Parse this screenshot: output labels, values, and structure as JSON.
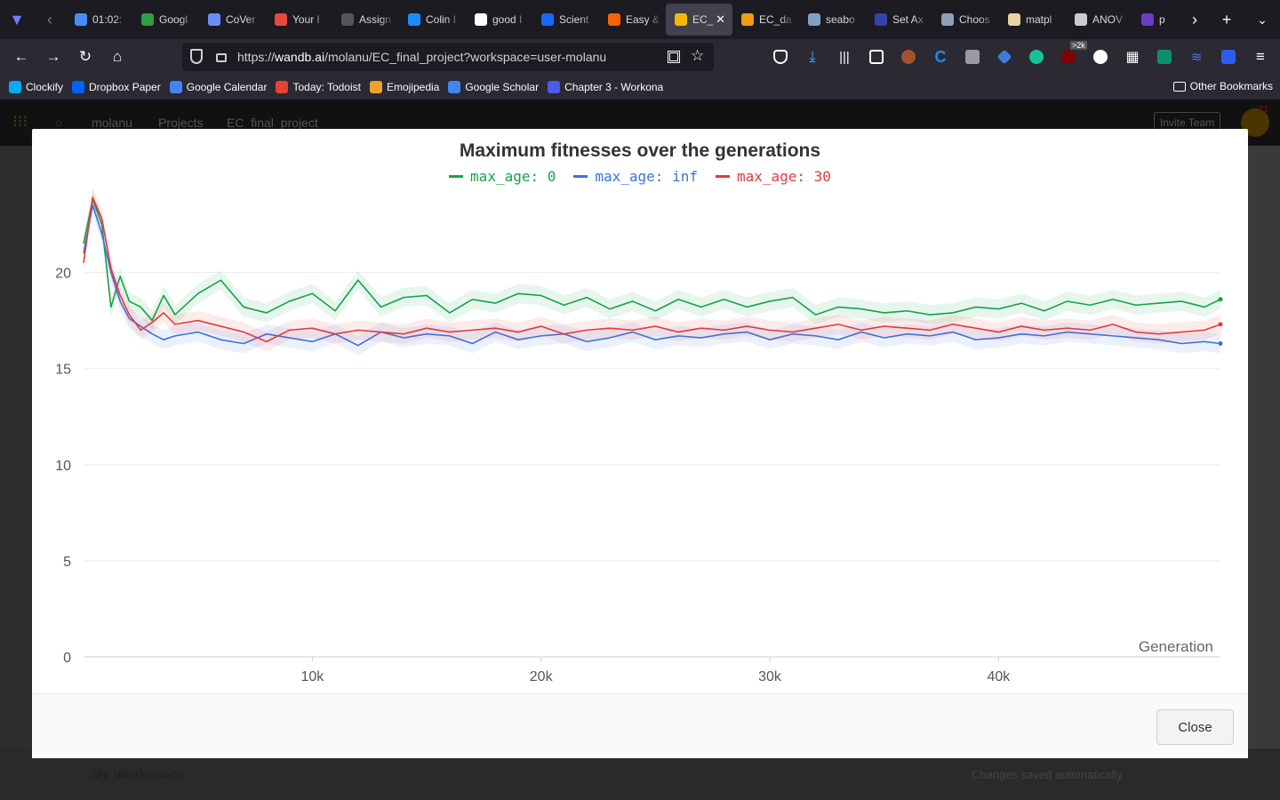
{
  "browser": {
    "tabs": [
      {
        "title": "01:02:",
        "color": "#4a8cf7"
      },
      {
        "title": "Googl",
        "color": "#2f9e44"
      },
      {
        "title": "CoVer",
        "color": "#6c8cf5"
      },
      {
        "title": "Your l",
        "color": "#e8483b"
      },
      {
        "title": "Assign",
        "color": "#555555"
      },
      {
        "title": "Colin I",
        "color": "#1a8cff"
      },
      {
        "title": "good I",
        "color": "#ffffff"
      },
      {
        "title": "Scient",
        "color": "#1769ff"
      },
      {
        "title": "Easy &",
        "color": "#f56400"
      },
      {
        "title": "EC_",
        "color": "#f5b800",
        "active": true
      },
      {
        "title": "EC_da",
        "color": "#f29a13"
      },
      {
        "title": "seabo",
        "color": "#7ea2c4"
      },
      {
        "title": "Set Ax",
        "color": "#3344aa"
      },
      {
        "title": "Choos",
        "color": "#8aa0b8"
      },
      {
        "title": "matpl",
        "color": "#e6d3a0"
      },
      {
        "title": "ANOV",
        "color": "#cccccc"
      },
      {
        "title": "p",
        "color": "#6a3cc8"
      }
    ],
    "url_prefix": "https://",
    "url_host": "wandb.ai",
    "url_path": "/molanu/EC_final_project?workspace=user-molanu",
    "badge": ">2k",
    "bookmarks": [
      {
        "label": "Clockify",
        "color": "#03a9f4"
      },
      {
        "label": "Dropbox Paper",
        "color": "#0061fe"
      },
      {
        "label": "Google Calendar",
        "color": "#4285f4"
      },
      {
        "label": "Today: Todoist",
        "color": "#e44332"
      },
      {
        "label": "Emojipedia",
        "color": "#f0a030"
      },
      {
        "label": "Google Scholar",
        "color": "#4285f4"
      },
      {
        "label": "Chapter 3 - Workona",
        "color": "#4a5cf0"
      }
    ],
    "other_bookmarks": "Other Bookmarks"
  },
  "page": {
    "breadcrumb": [
      "molanu",
      "Projects",
      "EC_final_project"
    ],
    "invite": "Invite Team",
    "workspace": "My Workspace",
    "saved": "Changes saved automatically",
    "notif_count": "21"
  },
  "modal": {
    "close_label": "Close"
  },
  "chart_data": {
    "type": "line",
    "title": "Maximum fitnesses over the generations",
    "xlabel": "Generation",
    "ylabel": "",
    "xlim": [
      0,
      49700
    ],
    "ylim": [
      0,
      24
    ],
    "x_ticks": [
      10000,
      20000,
      30000,
      40000
    ],
    "x_tick_labels": [
      "10k",
      "20k",
      "30k",
      "40k"
    ],
    "y_ticks": [
      0,
      5,
      10,
      15,
      20
    ],
    "legend_position": "top-center",
    "grid": true,
    "series": [
      {
        "name": "max_age: 0",
        "color": "#16a34a",
        "x": [
          0,
          400,
          800,
          1200,
          1600,
          2000,
          2500,
          3000,
          3500,
          4000,
          5000,
          6000,
          7000,
          8000,
          9000,
          10000,
          11000,
          12000,
          13000,
          14000,
          15000,
          16000,
          17000,
          18000,
          19000,
          20000,
          21000,
          22000,
          23000,
          24000,
          25000,
          26000,
          27000,
          28000,
          29000,
          30000,
          31000,
          32000,
          33000,
          34000,
          35000,
          36000,
          37000,
          38000,
          39000,
          40000,
          41000,
          42000,
          43000,
          44000,
          45000,
          46000,
          47000,
          48000,
          49000,
          49700
        ],
        "y": [
          21.5,
          23.8,
          22.5,
          18.2,
          19.8,
          18.5,
          18.2,
          17.5,
          18.8,
          17.8,
          18.9,
          19.6,
          18.2,
          17.9,
          18.5,
          18.9,
          18.0,
          19.6,
          18.2,
          18.7,
          18.8,
          17.9,
          18.6,
          18.4,
          18.9,
          18.8,
          18.3,
          18.7,
          18.1,
          18.5,
          18.0,
          18.6,
          18.2,
          18.6,
          18.2,
          18.5,
          18.7,
          17.8,
          18.2,
          18.1,
          17.9,
          18.0,
          17.8,
          17.9,
          18.2,
          18.1,
          18.4,
          18.0,
          18.5,
          18.3,
          18.6,
          18.3,
          18.4,
          18.5,
          18.2,
          18.6
        ]
      },
      {
        "name": "max_age: inf",
        "color": "#3b72e0",
        "x": [
          0,
          400,
          800,
          1200,
          1600,
          2000,
          2500,
          3000,
          3500,
          4000,
          5000,
          6000,
          7000,
          8000,
          9000,
          10000,
          11000,
          12000,
          13000,
          14000,
          15000,
          16000,
          17000,
          18000,
          19000,
          20000,
          21000,
          22000,
          23000,
          24000,
          25000,
          26000,
          27000,
          28000,
          29000,
          30000,
          31000,
          32000,
          33000,
          34000,
          35000,
          36000,
          37000,
          38000,
          39000,
          40000,
          41000,
          42000,
          43000,
          44000,
          45000,
          46000,
          47000,
          48000,
          49000,
          49700
        ],
        "y": [
          21.0,
          23.5,
          22.0,
          20.0,
          18.5,
          17.6,
          17.2,
          16.8,
          16.5,
          16.7,
          16.9,
          16.5,
          16.3,
          16.8,
          16.6,
          16.4,
          16.8,
          16.2,
          16.9,
          16.6,
          16.8,
          16.7,
          16.3,
          16.9,
          16.5,
          16.7,
          16.8,
          16.4,
          16.6,
          16.9,
          16.5,
          16.7,
          16.6,
          16.8,
          16.9,
          16.5,
          16.8,
          16.7,
          16.5,
          16.9,
          16.6,
          16.8,
          16.7,
          16.9,
          16.5,
          16.6,
          16.8,
          16.7,
          16.9,
          16.8,
          16.7,
          16.6,
          16.5,
          16.3,
          16.4,
          16.3
        ]
      },
      {
        "name": "max_age: 30",
        "color": "#e33a3a",
        "x": [
          0,
          400,
          800,
          1200,
          1600,
          2000,
          2500,
          3000,
          3500,
          4000,
          5000,
          6000,
          7000,
          8000,
          9000,
          10000,
          11000,
          12000,
          13000,
          14000,
          15000,
          16000,
          17000,
          18000,
          19000,
          20000,
          21000,
          22000,
          23000,
          24000,
          25000,
          26000,
          27000,
          28000,
          29000,
          30000,
          31000,
          32000,
          33000,
          34000,
          35000,
          36000,
          37000,
          38000,
          39000,
          40000,
          41000,
          42000,
          43000,
          44000,
          45000,
          46000,
          47000,
          48000,
          49000,
          49700
        ],
        "y": [
          20.5,
          23.9,
          22.8,
          20.2,
          18.8,
          17.8,
          17.0,
          17.4,
          17.9,
          17.3,
          17.5,
          17.2,
          16.9,
          16.4,
          17.0,
          17.1,
          16.8,
          17.0,
          16.9,
          16.8,
          17.1,
          16.9,
          17.0,
          17.1,
          16.9,
          17.2,
          16.8,
          17.0,
          17.1,
          17.0,
          17.2,
          16.9,
          17.1,
          17.0,
          17.2,
          17.0,
          16.9,
          17.1,
          17.3,
          17.0,
          17.2,
          17.1,
          17.0,
          17.3,
          17.1,
          16.9,
          17.2,
          17.0,
          17.1,
          17.0,
          17.3,
          16.9,
          16.8,
          16.9,
          17.0,
          17.3
        ]
      }
    ]
  }
}
